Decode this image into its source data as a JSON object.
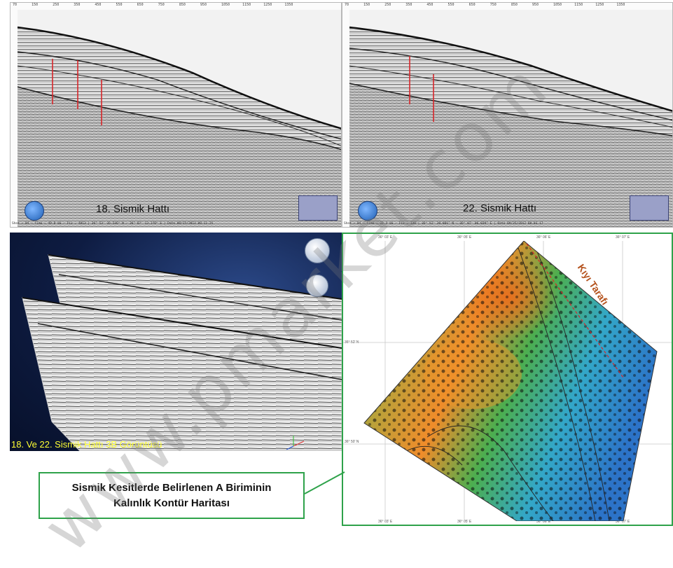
{
  "panels": {
    "seismic_left": {
      "caption": "18. Sismik Hattı",
      "status": "Shot = 84 – Time = 49.8 mS – Fix = 4813 | 36° 52' 26.536\" N – 36° 07' 13.170\" E | Date 09/25/2012 09.11.25"
    },
    "seismic_right": {
      "caption": "22. Sismik Hattı",
      "status": "Shot = 84 – Time = 24.4 mS – Fix = 130 | 36° 52' 39.001\" N – 36° 07' 06.039\" E | Date 09/25/2012 08.03.17"
    },
    "view3d": {
      "caption": "18. Ve 22. Sismik Hattı 3B Görüntüsü"
    },
    "map": {
      "top_ticks": [
        "36° 03' E",
        "36° 05' E",
        "36° 06' E",
        "36° 07' E"
      ],
      "bottom_ticks": [
        "36° 03' E",
        "36° 05' E",
        "36° 06' E",
        "36° 07' E"
      ],
      "left_ticks": [
        "36° 52' N",
        "36° 50' N"
      ],
      "shore_label": "Kıyı Tarafı"
    }
  },
  "callout": {
    "line1": "Sismik Kesitlerde Belirlenen A Biriminin",
    "line2": "Kalınlık Kontür  Haritası"
  },
  "watermark": {
    "text": "www.pmarket.com"
  },
  "colors": {
    "accent_green": "#2ea24a",
    "caption_yellow": "#ffff33",
    "shore_label": "#b5531e",
    "fault_red": "#d8262a"
  }
}
